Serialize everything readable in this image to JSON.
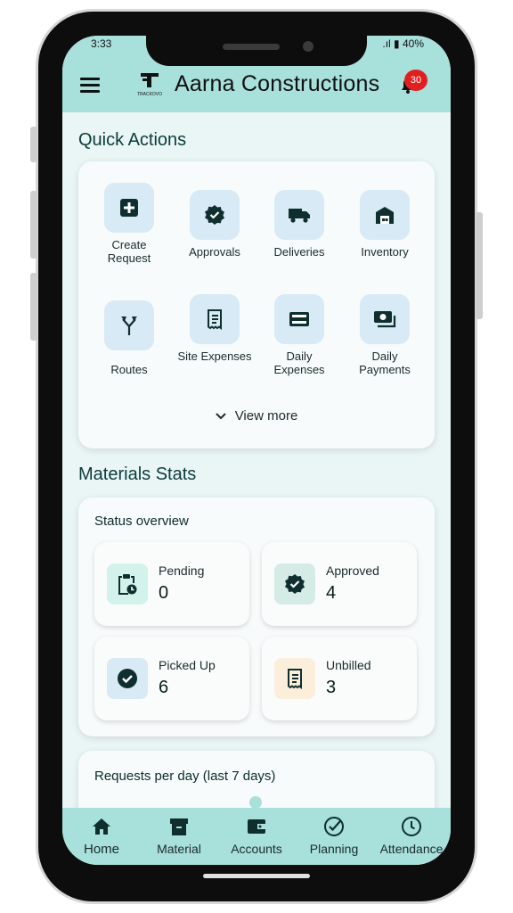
{
  "status_bar": {
    "time": "3:33",
    "battery": "40%"
  },
  "header": {
    "logo_text": "TRACKOVO",
    "title": "Aarna Constructions",
    "notification_count": "30"
  },
  "quick_actions": {
    "title": "Quick Actions",
    "items": [
      {
        "label": "Create Request",
        "icon": "plus-square-icon"
      },
      {
        "label": "Approvals",
        "icon": "verified-badge-icon"
      },
      {
        "label": "Deliveries",
        "icon": "truck-icon"
      },
      {
        "label": "Inventory",
        "icon": "warehouse-icon"
      },
      {
        "label": "Routes",
        "icon": "fork-arrows-icon"
      },
      {
        "label": "Site Expenses",
        "icon": "receipt-icon"
      },
      {
        "label": "Daily Expenses",
        "icon": "card-icon"
      },
      {
        "label": "Daily Payments",
        "icon": "cash-icon"
      }
    ],
    "view_more": "View more"
  },
  "materials_stats": {
    "title": "Materials Stats",
    "overview_title": "Status overview",
    "stats": [
      {
        "label": "Pending",
        "value": "0",
        "icon": "clipboard-clock-icon",
        "color": "#d3f2ec"
      },
      {
        "label": "Approved",
        "value": "4",
        "icon": "verified-badge-icon",
        "color": "#d5ebe6"
      },
      {
        "label": "Picked Up",
        "value": "6",
        "icon": "check-circle-icon",
        "color": "#d7eaf5"
      },
      {
        "label": "Unbilled",
        "value": "3",
        "icon": "receipt-icon",
        "color": "#fbeedb"
      }
    ],
    "requests_title": "Requests per day (last 7 days)"
  },
  "bottom_nav": [
    {
      "label": "Home",
      "icon": "home-icon"
    },
    {
      "label": "Material",
      "icon": "archive-icon"
    },
    {
      "label": "Accounts",
      "icon": "wallet-icon"
    },
    {
      "label": "Planning",
      "icon": "check-circle-outline-icon"
    },
    {
      "label": "Attendance",
      "icon": "clock-icon"
    }
  ],
  "colors": {
    "header": "#a8e0dc",
    "background": "#eaf6f5",
    "badge": "#e02020",
    "icon_tile": "#d7eaf5"
  }
}
